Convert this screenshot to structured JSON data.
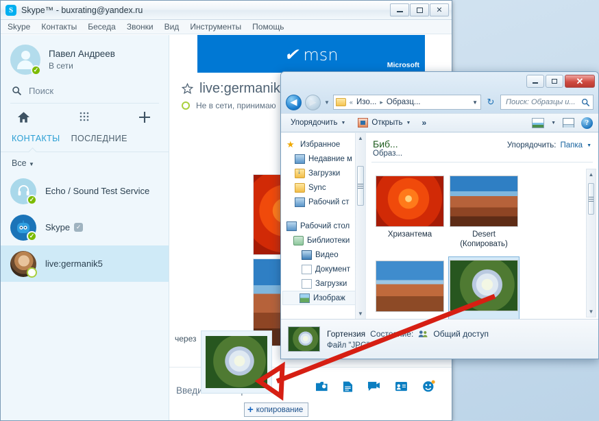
{
  "skype": {
    "title": "Skype™ - buxrating@yandex.ru",
    "logo": "S",
    "window_buttons": {
      "minimize": "minimize-icon",
      "maximize": "maximize-icon",
      "close": "close-icon"
    },
    "menu": [
      "Skype",
      "Контакты",
      "Беседа",
      "Звонки",
      "Вид",
      "Инструменты",
      "Помощь"
    ],
    "profile": {
      "name": "Павел Андреев",
      "status": "В сети"
    },
    "search_placeholder": "Поиск",
    "nav_icons": [
      "home-icon",
      "dialpad-icon",
      "plus-icon"
    ],
    "tabs": [
      {
        "label": "КОНТАКТЫ",
        "active": true
      },
      {
        "label": "ПОСЛЕДНИЕ",
        "active": false
      }
    ],
    "filter": "Все",
    "contacts": [
      {
        "name": "Echo / Sound Test Service",
        "presence": "online",
        "verified": false,
        "selected": false
      },
      {
        "name": "Skype",
        "presence": "online",
        "verified": true,
        "selected": false
      },
      {
        "name": "live:germanik5",
        "presence": "offline",
        "verified": false,
        "selected": true
      }
    ],
    "banner": {
      "brand": "msn",
      "corp": "Microsoft",
      "color": "#0078d4"
    },
    "conversation": {
      "name": "live:germanik",
      "status": "Не в сети, принимаю",
      "favorite_icon": "star-icon",
      "messages_time": "через",
      "compose_placeholder": "Введите сообщение",
      "compose_icons": [
        "send-photo-icon",
        "send-file-icon",
        "video-message-icon",
        "send-contact-icon",
        "emoticon-icon"
      ]
    },
    "drag_tooltip": "копирование"
  },
  "explorer": {
    "window_buttons": {
      "minimize": "minimize-icon",
      "maximize": "maximize-icon",
      "close": "close-icon"
    },
    "nav": {
      "back": "back-icon",
      "forward": "forward-icon",
      "history": "history-dropdown-icon",
      "refresh": "refresh-icon"
    },
    "breadcrumb": {
      "sep1": "«",
      "crumb1": "Изо...",
      "arrow": "▸",
      "crumb2": "Образц..."
    },
    "search_placeholder": "Поиск: Образцы и...",
    "toolbar": {
      "organize": "Упорядочить",
      "open": "Открыть",
      "more": "»",
      "view_icon": "change-view-icon",
      "preview_icon": "preview-pane-icon",
      "help_icon": "help-icon"
    },
    "tree": [
      {
        "label": "Избранное",
        "icon": "star-icon",
        "indent": 0
      },
      {
        "label": "Недавние м",
        "icon": "recent-places-icon",
        "indent": 1
      },
      {
        "label": "Загрузки",
        "icon": "downloads-folder-icon",
        "indent": 1
      },
      {
        "label": "Sync",
        "icon": "folder-icon",
        "indent": 1
      },
      {
        "label": "Рабочий ст",
        "icon": "desktop-icon",
        "indent": 1
      },
      {
        "label": "Рабочий стол",
        "icon": "desktop-icon",
        "indent": 0
      },
      {
        "label": "Библиотеки",
        "icon": "libraries-icon",
        "indent": 1
      },
      {
        "label": "Видео",
        "icon": "video-library-icon",
        "indent": 2
      },
      {
        "label": "Документ",
        "icon": "documents-library-icon",
        "indent": 2
      },
      {
        "label": "Загрузки",
        "icon": "downloads-library-icon",
        "indent": 2
      },
      {
        "label": "Изображ",
        "icon": "pictures-library-icon",
        "indent": 2,
        "selected": true
      }
    ],
    "library": {
      "title": "Биб...",
      "subtitle": "Образ...",
      "arrange_label": "Упорядочить:",
      "arrange_value": "Папка"
    },
    "files": [
      {
        "caption": "Хризантема",
        "image": "chrysanthemum",
        "selected": false
      },
      {
        "caption": "Desert (Копировать)",
        "image": "desert",
        "selected": false
      },
      {
        "caption": "",
        "image": "desert2",
        "selected": false
      },
      {
        "caption": "",
        "image": "hydrangea",
        "selected": true
      }
    ],
    "status": {
      "name": "Гортензия",
      "state_label": "Состояние:",
      "state_value": "Общий доступ",
      "type": "Файл \"JPG\"",
      "thumb": "hydrangea"
    }
  },
  "annotation": {
    "arrow_color": "#d61f13"
  }
}
